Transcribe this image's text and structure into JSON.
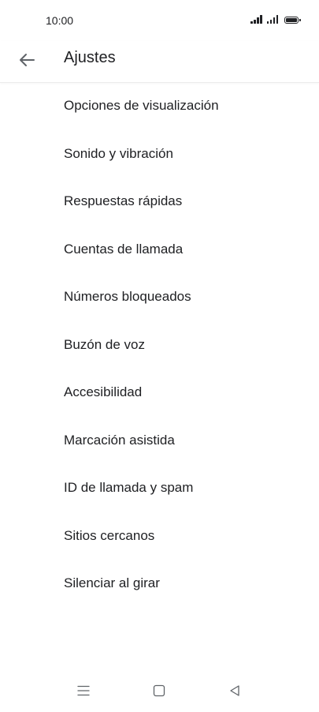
{
  "status_bar": {
    "time": "10:00",
    "icons": [
      "signal-icon",
      "signal-icon",
      "battery-icon"
    ]
  },
  "app_bar": {
    "back_icon": "arrow-left-icon",
    "title": "Ajustes"
  },
  "settings": {
    "items": [
      {
        "label": "Opciones de visualización"
      },
      {
        "label": "Sonido y vibración"
      },
      {
        "label": "Respuestas rápidas"
      },
      {
        "label": "Cuentas de llamada"
      },
      {
        "label": "Números bloqueados"
      },
      {
        "label": "Buzón de voz"
      },
      {
        "label": "Accesibilidad"
      },
      {
        "label": "Marcación asistida"
      },
      {
        "label": "ID de llamada y spam"
      },
      {
        "label": "Sitios cercanos"
      },
      {
        "label": "Silenciar al girar"
      }
    ]
  },
  "nav_bar": {
    "icons": [
      "menu-icon",
      "home-icon",
      "back-triangle-icon"
    ]
  },
  "colors": {
    "text": "#202124",
    "icon": "#5f6368",
    "background": "#ffffff",
    "divider": "#ececec"
  }
}
